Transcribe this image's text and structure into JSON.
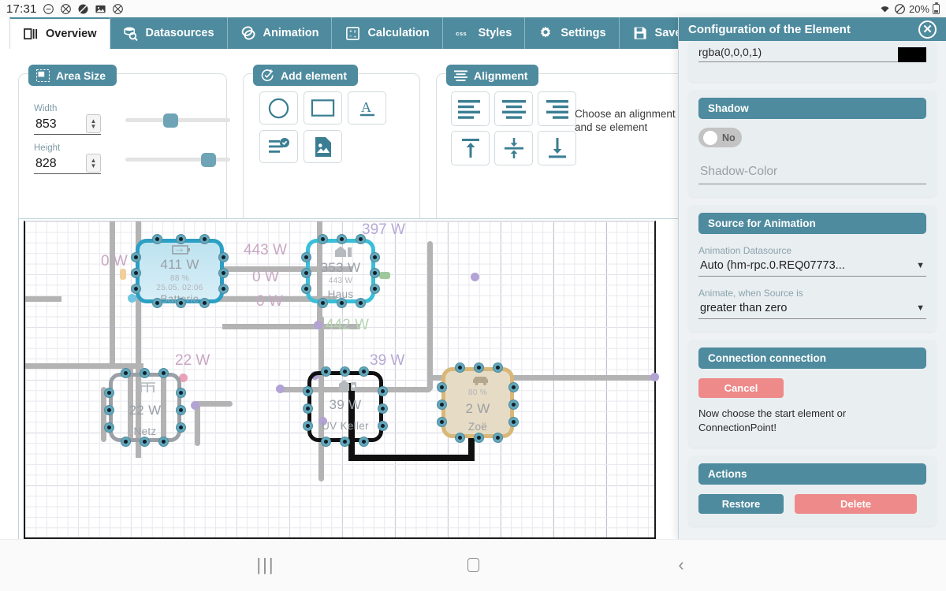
{
  "statusbar": {
    "clock": "17:31",
    "icons": [
      "minus-circle-icon",
      "crossed-circle-icon",
      "dnd-slash-icon",
      "image-icon",
      "crossed-circle-icon-2"
    ],
    "battery_percent": "20%",
    "right_icons": [
      "wifi-icon",
      "do-not-disturb-icon",
      "battery-icon"
    ]
  },
  "tabs": [
    {
      "label": "Overview",
      "icon": "layout-overview-icon",
      "active": true
    },
    {
      "label": "Datasources",
      "icon": "database-search-icon",
      "active": false
    },
    {
      "label": "Animation",
      "icon": "layers-animation-icon",
      "active": false
    },
    {
      "label": "Calculation",
      "icon": "calculator-icon",
      "active": false
    },
    {
      "label": "Styles",
      "icon": "css-icon",
      "active": false
    },
    {
      "label": "Settings",
      "icon": "gear-icon",
      "active": false
    },
    {
      "label": "Save",
      "icon": "floppy-disk-icon",
      "active": false
    }
  ],
  "area_size": {
    "title": "Area Size",
    "icon": "area-size-icon",
    "width_label": "Width",
    "width_value": "853",
    "height_label": "Height",
    "height_value": "828"
  },
  "add_element": {
    "title": "Add element",
    "icon": "add-check-icon",
    "buttons": [
      {
        "name": "add-circle-button",
        "icon": "circle-icon"
      },
      {
        "name": "add-rectangle-button",
        "icon": "rectangle-icon"
      },
      {
        "name": "add-text-button",
        "icon": "text-a-icon"
      },
      {
        "name": "add-list-button",
        "icon": "list-check-icon"
      },
      {
        "name": "add-image-button",
        "icon": "image-file-icon"
      }
    ]
  },
  "alignment": {
    "title": "Alignment",
    "icon": "alignment-lines-icon",
    "hint": "Choose an alignment and se element",
    "buttons": [
      {
        "name": "align-left-button",
        "icon": "align-left-icon"
      },
      {
        "name": "align-center-button",
        "icon": "align-center-icon"
      },
      {
        "name": "align-right-button",
        "icon": "align-right-icon"
      },
      {
        "name": "align-top-button",
        "icon": "align-top-icon"
      },
      {
        "name": "align-middle-vertical-button",
        "icon": "align-middle-icon"
      },
      {
        "name": "align-bottom-button",
        "icon": "align-bottom-icon"
      }
    ]
  },
  "config_panel": {
    "title": "Configuration of the Element",
    "close_icon": "close-circle-icon",
    "color_field": {
      "value": "rgba(0,0,0,1)",
      "swatch_color": "#000000"
    },
    "shadow": {
      "title": "Shadow",
      "toggle_value": "No",
      "color_placeholder": "Shadow-Color"
    },
    "animation": {
      "title": "Source for Animation",
      "datasource_label": "Animation Datasource",
      "datasource_value": "Auto (hm-rpc.0.REQ07773...",
      "condition_label": "Animate, when Source is",
      "condition_value": "greater than zero"
    },
    "connection": {
      "title": "Connection connection",
      "cancel_label": "Cancel",
      "note": "Now choose the start element or ConnectionPoint!"
    },
    "actions": {
      "title": "Actions",
      "restore_label": "Restore",
      "delete_label": "Delete"
    }
  },
  "canvas": {
    "nodes": [
      {
        "name": "node-batterie",
        "power": "411 W",
        "percent": "88 %",
        "timestamp": "25.05. 02:06",
        "title": "Batterie",
        "icon": "battery-node-icon",
        "color": "#2b9fc4",
        "fill": "#bde3f0"
      },
      {
        "name": "node-haus",
        "power": "353 W",
        "percent": "443 W",
        "timestamp": "",
        "title": "Haus",
        "icon": "house-node-icon",
        "color": "#39bfd8",
        "fill": "transparent"
      },
      {
        "name": "node-netz",
        "power": "22 W",
        "percent": "",
        "timestamp": "",
        "title": "Netz",
        "icon": "grid-node-icon",
        "color": "#9aa0a6",
        "fill": "transparent"
      },
      {
        "name": "node-uv-keller",
        "power": "39 W",
        "percent": "",
        "timestamp": "",
        "title": "UV Keller",
        "icon": "house-lock-node-icon",
        "color": "#101010",
        "fill": "transparent"
      },
      {
        "name": "node-zoe",
        "power": "2 W",
        "percent": "80 %",
        "timestamp": "",
        "title": "Zoë",
        "icon": "car-node-icon",
        "color": "#d9b778",
        "fill": "#e6dbc4"
      }
    ],
    "wire_labels": [
      {
        "text": "0 W",
        "color": "pink"
      },
      {
        "text": "443 W",
        "color": "pink"
      },
      {
        "text": "397 W",
        "color": "purple"
      },
      {
        "text": "0 W",
        "color": "pink"
      },
      {
        "text": "0 W",
        "color": "pink"
      },
      {
        "text": "442 W",
        "color": "green"
      },
      {
        "text": "22 W",
        "color": "pink"
      },
      {
        "text": "39 W",
        "color": "purple"
      }
    ]
  },
  "navbar": {
    "recent_label": "|||",
    "home_icon": "home-square-icon",
    "back_icon": "back-chevron-icon"
  }
}
